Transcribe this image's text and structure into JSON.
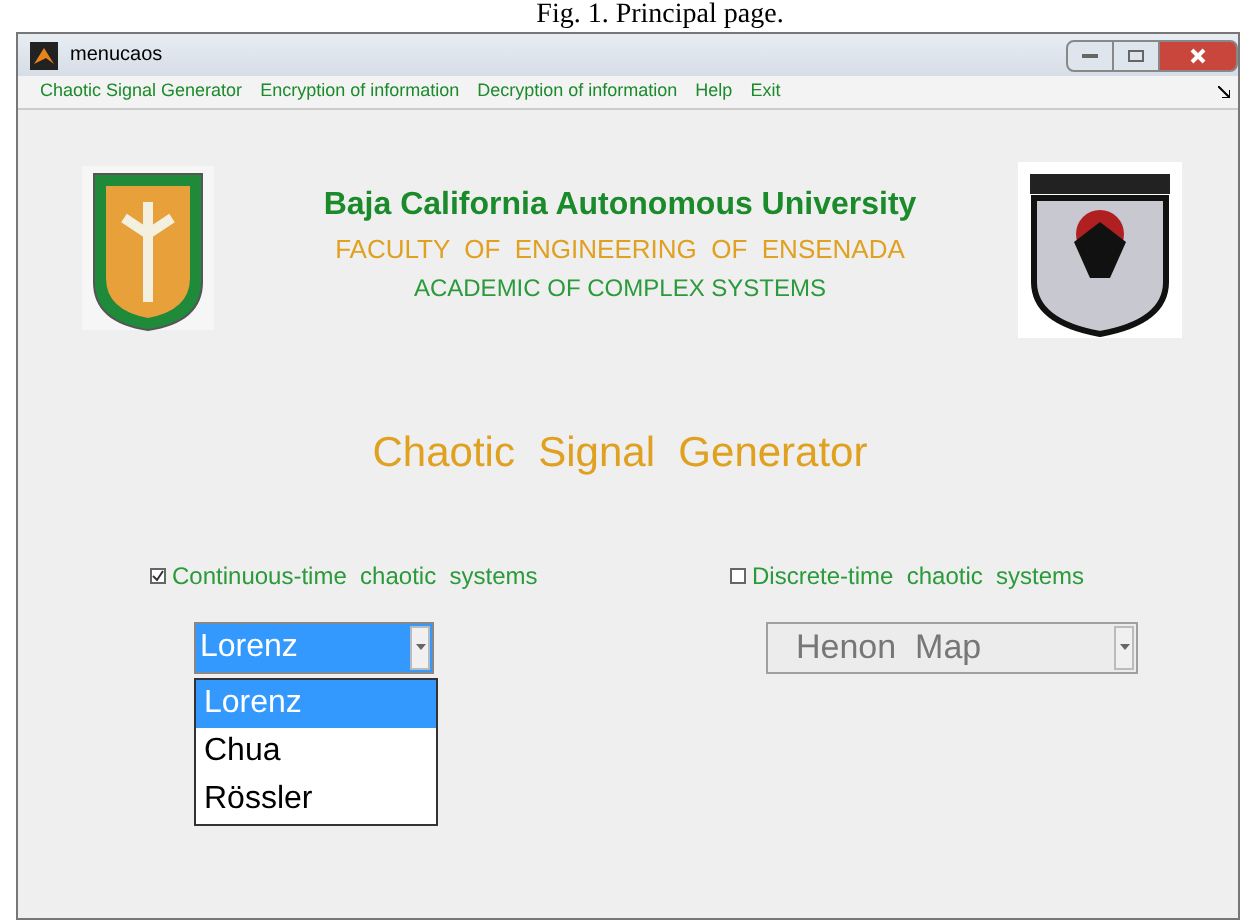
{
  "caption": "Fig. 1. Principal page.",
  "window": {
    "title": "menucaos"
  },
  "menu": [
    "Chaotic Signal Generator",
    "Encryption of information",
    "Decryption of information",
    "Help",
    "Exit"
  ],
  "header": {
    "university": "Baja California Autonomous University",
    "faculty": "FACULTY  OF  ENGINEERING  OF  ENSENADA",
    "academy": "ACADEMIC OF COMPLEX SYSTEMS"
  },
  "heading": "Chaotic  Signal  Generator",
  "options": [
    {
      "label": "Continuous-time  chaotic  systems",
      "checked": true,
      "popup": {
        "value": "Lorenz",
        "disabled": false,
        "items": [
          {
            "label": "Lorenz",
            "selected": true
          },
          {
            "label": "Chua",
            "selected": false
          },
          {
            "label": "Rössler",
            "selected": false
          }
        ]
      }
    },
    {
      "label": "Discrete-time  chaotic  systems",
      "checked": false,
      "popup": {
        "value": "Henon  Map",
        "disabled": true
      }
    }
  ]
}
